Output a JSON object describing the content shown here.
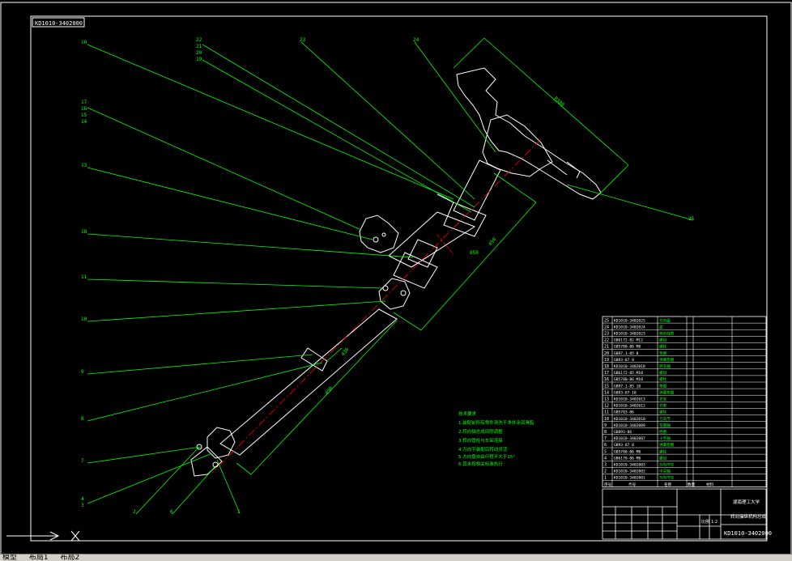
{
  "drawing": {
    "drawing_number_top": "KD1010-3402000",
    "drawing_number_bottom": "KD1010-3402000",
    "title": "转向操纵机构总成",
    "school": "湖南理工大学",
    "callouts_left": [
      "10",
      "17",
      "16",
      "15",
      "14",
      "13",
      "18",
      "11",
      "10",
      "9",
      "8",
      "7",
      "4",
      "3",
      "2",
      "6",
      "1"
    ],
    "callouts_top": [
      "22",
      "21",
      "20",
      "19",
      "23",
      "24"
    ],
    "callout_right": "25",
    "dimensions": [
      "R380",
      "450",
      "450",
      "430",
      "850"
    ],
    "tech_requirements_title": "技术要求",
    "tech_requirements": [
      "1.装配前所有零件清洗干净并涂润滑脂",
      "2.转向轴总成间隙调整",
      "3.转向管柱与车架连接",
      "4.万向节装配后转动灵活",
      "5.方向盘自由行程不大于15°",
      "6.其余按相关标准执行"
    ],
    "parts_list": [
      {
        "no": "25",
        "code": "KD1010-3402025",
        "name": "方向盘"
      },
      {
        "no": "24",
        "code": "KD1010-3402024",
        "name": "盖"
      },
      {
        "no": "23",
        "code": "KD1010-3402023",
        "name": "转向柱管"
      },
      {
        "no": "22",
        "code": "GB6172-82 M12",
        "name": "螺母"
      },
      {
        "no": "21",
        "code": "GB5780-86 M8",
        "name": "螺栓"
      },
      {
        "no": "20",
        "code": "GB97.1-85 8",
        "name": "垫圈"
      },
      {
        "no": "19",
        "code": "GB93-87 8",
        "name": "弹簧垫圈"
      },
      {
        "no": "18",
        "code": "KD1010-3402018",
        "name": "转向轴"
      },
      {
        "no": "17",
        "code": "GB6172-85 M10",
        "name": "螺母"
      },
      {
        "no": "16",
        "code": "GB5780-86 M10",
        "name": "螺栓"
      },
      {
        "no": "15",
        "code": "GB97.1-85 10",
        "name": "垫圈"
      },
      {
        "no": "14",
        "code": "GB93-87 10",
        "name": "弹簧垫圈"
      },
      {
        "no": "13",
        "code": "KD1010-3402013",
        "name": "支架"
      },
      {
        "no": "12",
        "code": "KD1010-3402012",
        "name": "衬套"
      },
      {
        "no": "11",
        "code": "GB5783-86",
        "name": "螺栓"
      },
      {
        "no": "10",
        "code": "KD1010-3402010",
        "name": "万向节"
      },
      {
        "no": "9",
        "code": "KD1010-3402009",
        "name": "花键轴"
      },
      {
        "no": "8",
        "code": "GB893-86",
        "name": "挡圈"
      },
      {
        "no": "7",
        "code": "KD1010-3402007",
        "name": "十字轴"
      },
      {
        "no": "6",
        "code": "GB93-87 8",
        "name": "弹簧垫圈"
      },
      {
        "no": "5",
        "code": "GB5780-86 M8",
        "name": "螺栓"
      },
      {
        "no": "4",
        "code": "GB6170-86 M8",
        "name": "螺母"
      },
      {
        "no": "3",
        "code": "KD1010-3402003",
        "name": "万向节叉"
      },
      {
        "no": "2",
        "code": "KD1010-3402002",
        "name": "中间轴"
      },
      {
        "no": "1",
        "code": "KD1010-3402001",
        "name": "万向节叉"
      }
    ],
    "parts_header": [
      "序号",
      "代号",
      "名称",
      "数量",
      "材料"
    ],
    "scale_label": "比例",
    "scale_value": "1:2"
  },
  "statusbar": {
    "tab_model": "模型",
    "tab_layout1": "布局1",
    "tab_layout2": "布局2"
  },
  "colors": {
    "background": "#000000",
    "line": "#ffffff",
    "leader": "#00ff00",
    "center": "#ff0000",
    "dimension": "#00ff00",
    "text": "#00ff00"
  }
}
